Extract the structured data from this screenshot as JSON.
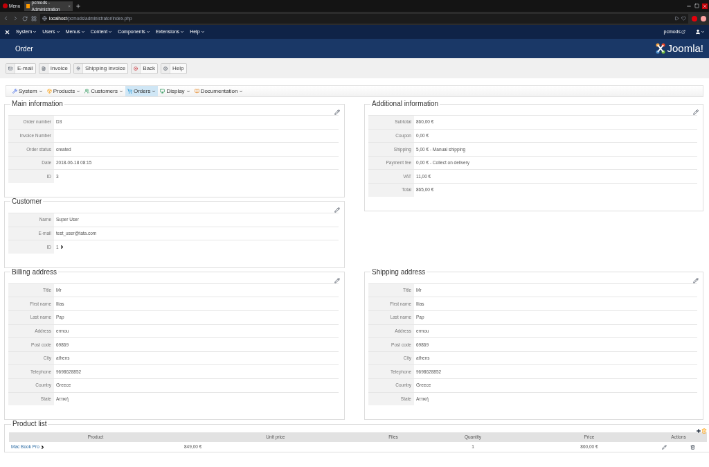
{
  "browser": {
    "menu_label": "Menu",
    "tab_title": "pcmods - Administration",
    "url_host": "localhost",
    "url_path": "/pcmods/administrator/index.php"
  },
  "top_menu": {
    "items": [
      "System",
      "Users",
      "Menus",
      "Content",
      "Components",
      "Extensions",
      "Help"
    ],
    "site": "pcmods"
  },
  "header": {
    "title": "Order",
    "logo": "Joomla!"
  },
  "toolbar": [
    {
      "kind": "mail",
      "label": "E-mail"
    },
    {
      "kind": "invoice",
      "label": "Invoice"
    },
    {
      "kind": "pin",
      "label": "Shipping invoice"
    },
    {
      "kind": "back",
      "label": "Back"
    },
    {
      "kind": "help",
      "label": "Help"
    }
  ],
  "submenu": [
    {
      "kind": "system",
      "label": "System",
      "selected": false
    },
    {
      "kind": "products",
      "label": "Products",
      "selected": false
    },
    {
      "kind": "customers",
      "label": "Customers",
      "selected": false
    },
    {
      "kind": "orders",
      "label": "Orders",
      "selected": true
    },
    {
      "kind": "display",
      "label": "Display",
      "selected": false
    },
    {
      "kind": "docs",
      "label": "Documentation",
      "selected": false
    }
  ],
  "main_information": {
    "title": "Main information",
    "fields": [
      {
        "label": "Order number",
        "value": "D3"
      },
      {
        "label": "Invoice Number"
      },
      {
        "label": "Order status",
        "value": "created"
      },
      {
        "label": "Date",
        "value": "2018-06-18 08:15"
      },
      {
        "label": "ID",
        "value": "3"
      }
    ]
  },
  "customer": {
    "title": "Customer",
    "fields": [
      {
        "label": "Name",
        "value": "Super User"
      },
      {
        "label": "E-mail",
        "value": "test_user@tata.com"
      },
      {
        "label": "ID",
        "value": "1",
        "link": true
      }
    ]
  },
  "additional_information": {
    "title": "Additional information",
    "fields": [
      {
        "label": "Subtotal",
        "value": "860,00 €"
      },
      {
        "label": "Coupon",
        "value": "0,00 €"
      },
      {
        "label": "Shipping",
        "value": "5,00 € - Manual shipping"
      },
      {
        "label": "Payment fee",
        "value": "0,00 € - Collect on delivery"
      },
      {
        "label": "VAT",
        "value": "11,00 €"
      },
      {
        "label": "Total",
        "value": "865,00 €"
      }
    ]
  },
  "billing_address": {
    "title": "Billing address",
    "fields": [
      {
        "label": "Title",
        "value": "Mr"
      },
      {
        "label": "First name",
        "value": "Ilias"
      },
      {
        "label": "Last name",
        "value": "Pap"
      },
      {
        "label": "Address",
        "value": "ermou"
      },
      {
        "label": "Post code",
        "value": "69869"
      },
      {
        "label": "City",
        "value": "athens"
      },
      {
        "label": "Telephone",
        "value": "9698628852"
      },
      {
        "label": "Country",
        "value": "Greece"
      },
      {
        "label": "State",
        "value": "Αττική"
      }
    ]
  },
  "shipping_address": {
    "title": "Shipping address",
    "fields": [
      {
        "label": "Title",
        "value": "Mr"
      },
      {
        "label": "First name",
        "value": "Ilias"
      },
      {
        "label": "Last name",
        "value": "Pap"
      },
      {
        "label": "Address",
        "value": "ermou"
      },
      {
        "label": "Post code",
        "value": "69869"
      },
      {
        "label": "City",
        "value": "athens"
      },
      {
        "label": "Telephone",
        "value": "9698628852"
      },
      {
        "label": "Country",
        "value": "Greece"
      },
      {
        "label": "State",
        "value": "Αττική"
      }
    ]
  },
  "product_list": {
    "title": "Product list",
    "columns": [
      "Product",
      "Unit price",
      "Files",
      "Quantity",
      "Price",
      "Actions"
    ],
    "rows": [
      {
        "product": "Mac Book Pro",
        "unit_price": "849,00 €",
        "quantity": "1",
        "price": "860,00 €"
      }
    ]
  }
}
